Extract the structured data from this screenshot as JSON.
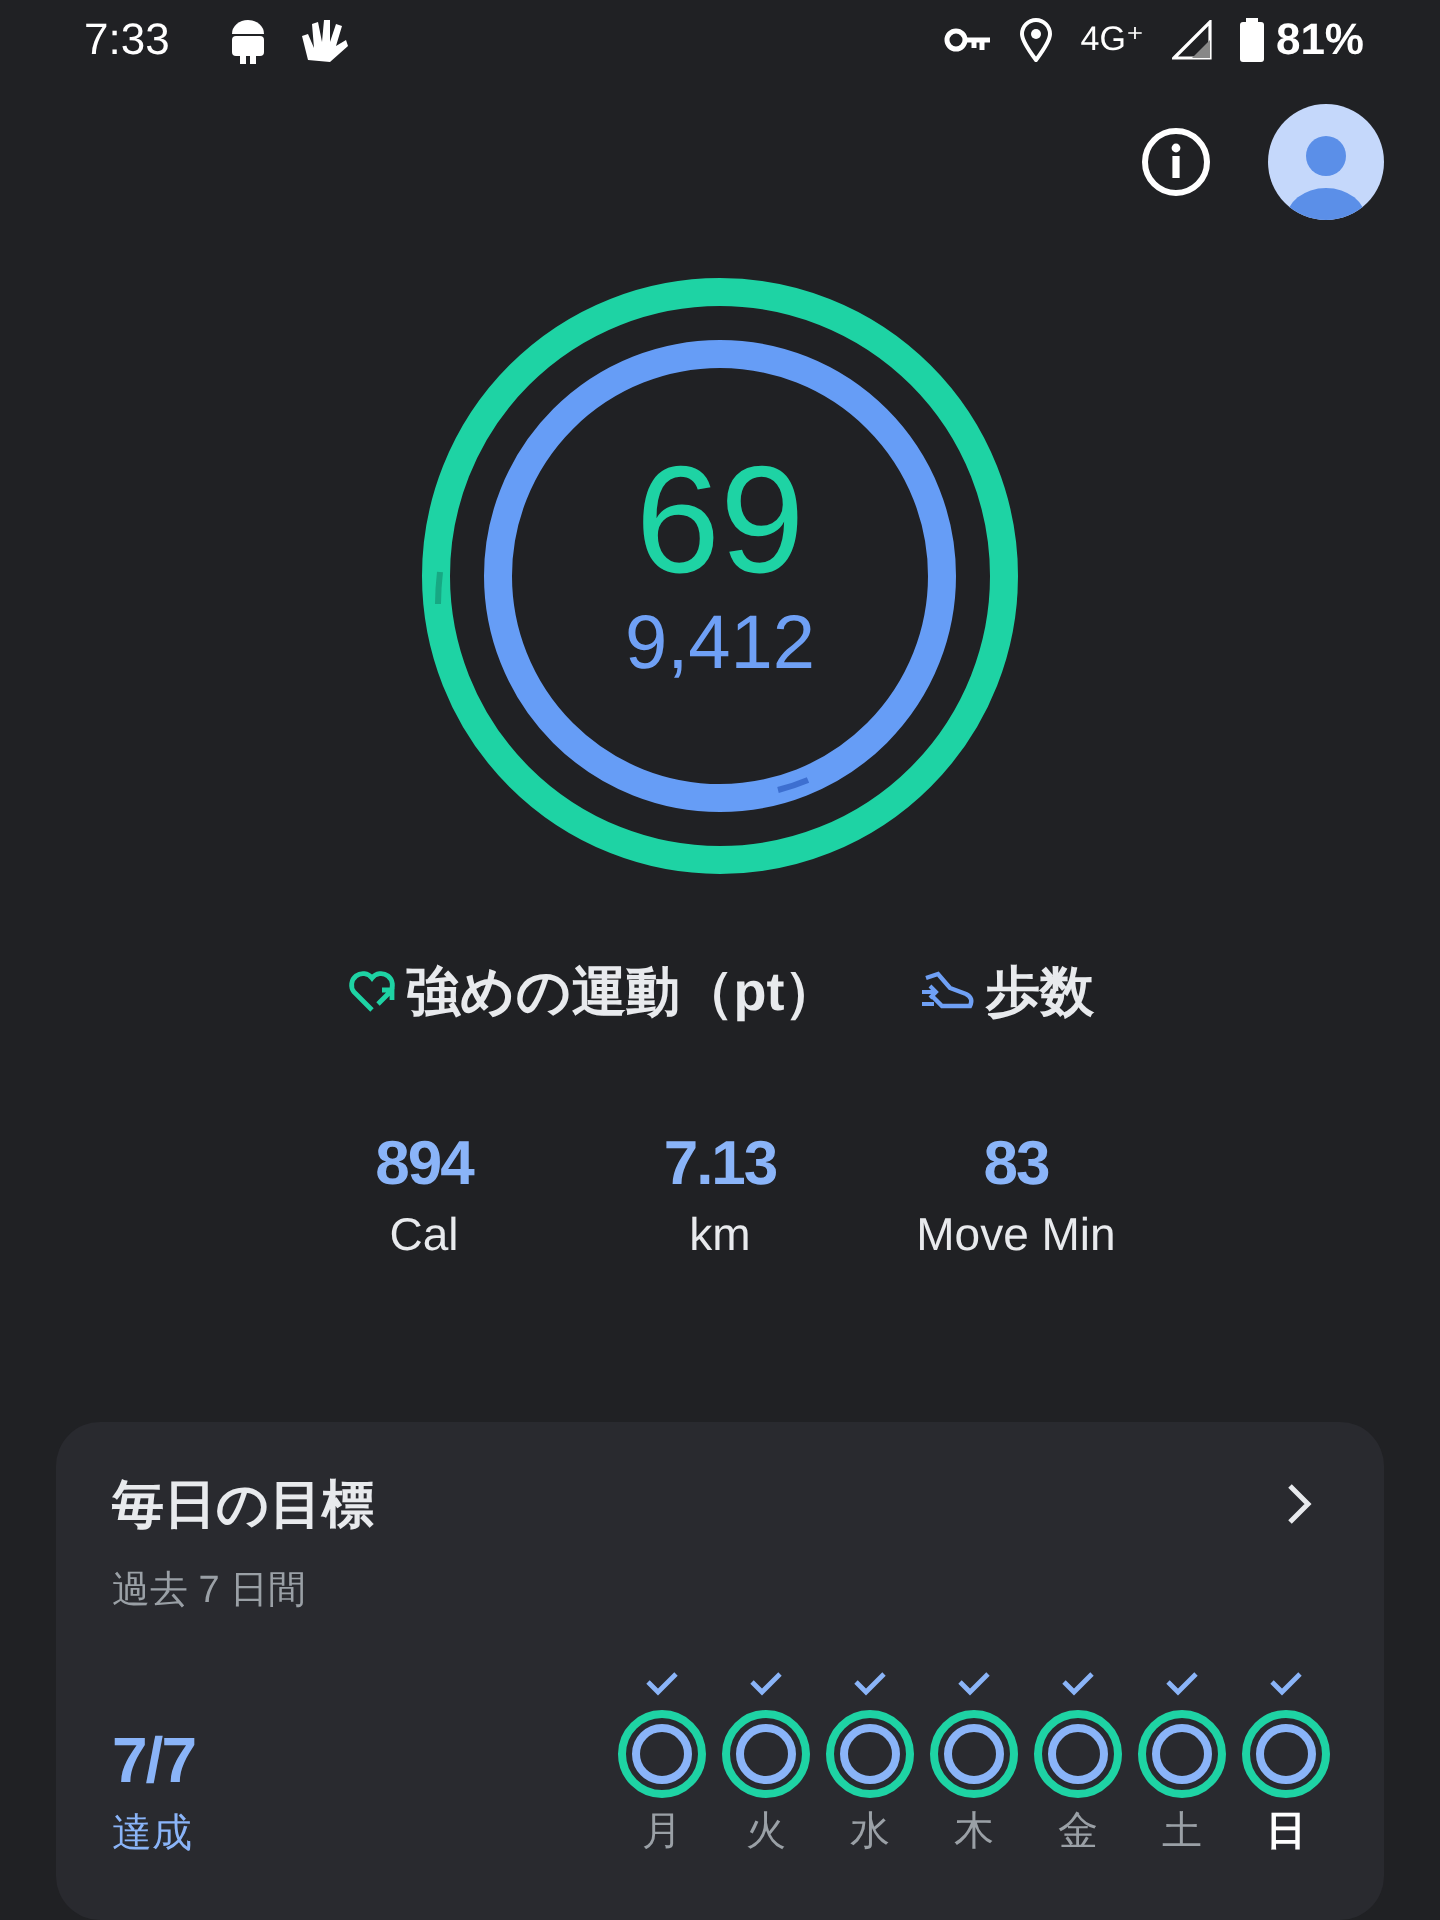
{
  "status_bar": {
    "time": "7:33",
    "network": "4G⁺",
    "battery": "81%"
  },
  "summary": {
    "heart_points": "69",
    "steps": "9,412"
  },
  "legend": [
    {
      "kind": "heart",
      "label": "強めの運動（pt）"
    },
    {
      "kind": "steps",
      "label": "歩数"
    }
  ],
  "stats": [
    {
      "value": "894",
      "label": "Cal"
    },
    {
      "value": "7.13",
      "label": "km"
    },
    {
      "value": "83",
      "label": "Move Min"
    }
  ],
  "daily_goals": {
    "title": "毎日の目標",
    "subtitle": "過去 7 日間",
    "achieved": "7/7",
    "achieved_label": "達成",
    "days": [
      {
        "label": "月",
        "checked": true,
        "selected": false
      },
      {
        "label": "火",
        "checked": true,
        "selected": false
      },
      {
        "label": "水",
        "checked": true,
        "selected": false
      },
      {
        "label": "木",
        "checked": true,
        "selected": false
      },
      {
        "label": "金",
        "checked": true,
        "selected": false
      },
      {
        "label": "土",
        "checked": true,
        "selected": false
      },
      {
        "label": "日",
        "checked": true,
        "selected": true
      }
    ]
  }
}
